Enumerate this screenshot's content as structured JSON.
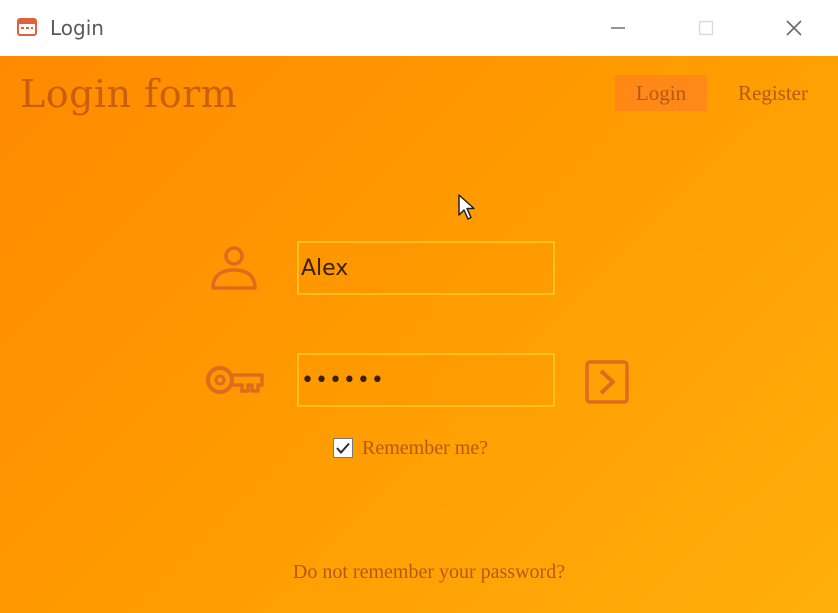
{
  "window": {
    "title": "Login"
  },
  "header": {
    "form_title": "Login form",
    "nav": {
      "login_label": "Login",
      "register_label": "Register"
    }
  },
  "form": {
    "username": {
      "value": "Alex",
      "icon": "user-icon"
    },
    "password": {
      "value": "••••••",
      "icon": "key-icon"
    },
    "submit_icon": "chevron-right-icon",
    "remember": {
      "label": "Remember me?",
      "checked": true
    },
    "forgot_label": "Do not remember your password?"
  },
  "colors": {
    "gradient_start": "#ff8a00",
    "gradient_end": "#ffaf0a",
    "accent_text": "#b45a16",
    "field_border": "#ffc828",
    "app_icon": "#e0623a"
  }
}
